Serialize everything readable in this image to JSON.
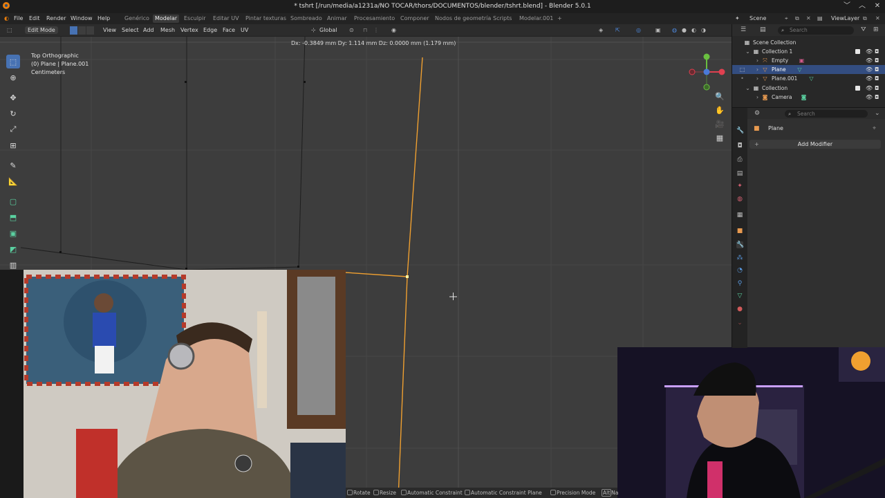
{
  "window": {
    "title": "* tshrt [/run/media/a1231a/NO TOCAR/thors/DOCUMENTOS/blender/tshrt.blend] - Blender 5.0.1",
    "buttons": [
      "﹀",
      "︿",
      "✕"
    ]
  },
  "menu": [
    "File",
    "Edit",
    "Render",
    "Window",
    "Help"
  ],
  "workspaces": [
    {
      "label": "Genérico",
      "active": false
    },
    {
      "label": "Modelar",
      "active": true
    },
    {
      "label": "Esculpir",
      "active": false
    },
    {
      "label": "Editar UV",
      "active": false
    },
    {
      "label": "Pintar texturas",
      "active": false
    },
    {
      "label": "Sombreado",
      "active": false
    },
    {
      "label": "Animar",
      "active": false
    },
    {
      "label": "Procesamiento",
      "active": false
    },
    {
      "label": "Componer",
      "active": false
    },
    {
      "label": "Nodos de geometría",
      "active": false
    },
    {
      "label": "Scripts",
      "active": false
    },
    {
      "label": "Modelar.001",
      "active": false
    }
  ],
  "add_workspace": "+",
  "scene": {
    "label": "Scene",
    "viewlayer": "ViewLayer"
  },
  "viewport_header": {
    "mode": "Edit Mode",
    "menus": [
      "View",
      "Select",
      "Add",
      "Mesh",
      "Vertex",
      "Edge",
      "Face",
      "UV"
    ],
    "orientation": "Global"
  },
  "viewport": {
    "view_name": "Top Orthographic",
    "object_info": "(0) Plane | Plane.001",
    "units": "Centimeters",
    "transform_readout": "Dx: -0.3849 mm   Dy: 1.114 mm   Dz: 0.0000 mm (1.179 mm)"
  },
  "toolbar_icons": [
    "select-box-icon",
    "cursor-icon",
    "move-icon",
    "rotate-icon",
    "scale-icon",
    "transform-icon",
    "annotate-icon",
    "measure-icon",
    "add-cube-icon",
    "extrude-icon",
    "inset-icon",
    "bevel-icon",
    "loop-cut-icon"
  ],
  "status_bar": [
    {
      "key": "",
      "label": "Rotate"
    },
    {
      "key": "",
      "label": "Resize"
    },
    {
      "key": "",
      "label": "Automatic Constraint"
    },
    {
      "key": "",
      "label": "Automatic Constraint Plane"
    },
    {
      "key": "",
      "label": "Precision Mode"
    },
    {
      "key": "Alt",
      "label": "Na"
    }
  ],
  "outliner": {
    "search_placeholder": "Search",
    "rows": [
      {
        "label": "Scene Collection",
        "indent": 0,
        "selected": false
      },
      {
        "label": "Collection 1",
        "indent": 1,
        "selected": false
      },
      {
        "label": "Empty",
        "indent": 2,
        "selected": false
      },
      {
        "label": "Plane",
        "indent": 2,
        "selected": true
      },
      {
        "label": "Plane.001",
        "indent": 2,
        "selected": false
      },
      {
        "label": "Collection",
        "indent": 1,
        "selected": false
      },
      {
        "label": "Camera",
        "indent": 2,
        "selected": false
      }
    ]
  },
  "properties": {
    "search_placeholder": "Search",
    "object_name": "Plane",
    "add_modifier": "Add Modifier"
  },
  "colors": {
    "accent": "#4772b3",
    "selected_edge": "#f0a030",
    "viewport_bg": "#3d3d3d"
  }
}
